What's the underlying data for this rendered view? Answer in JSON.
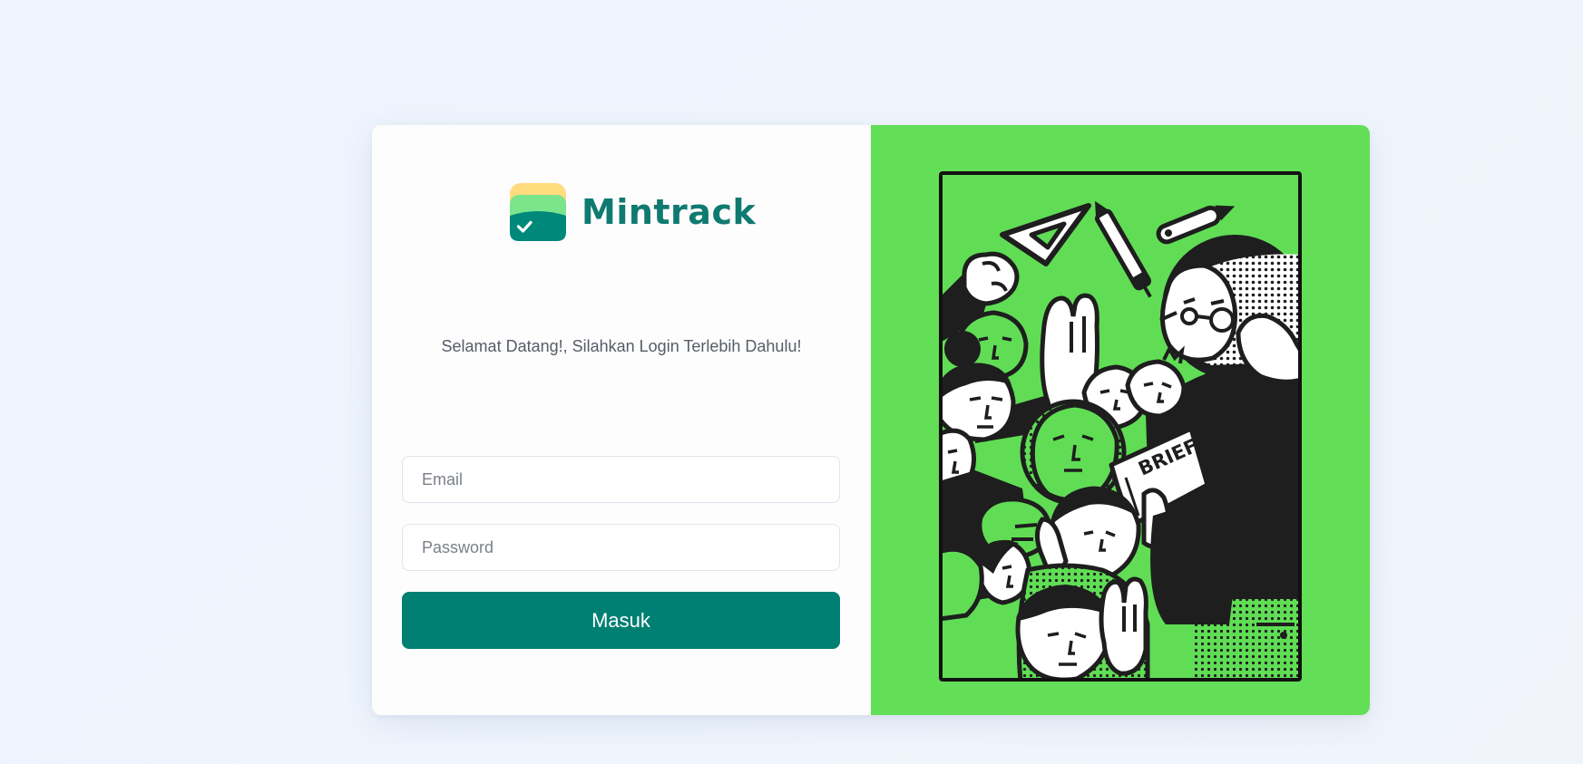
{
  "brand": {
    "name": "Mintrack",
    "icon": "wallet-check-icon",
    "colors": {
      "primary": "#007f73",
      "logo_yellow": "#ffdc7d",
      "logo_light_green": "#7be58c",
      "logo_dark_green": "#00897b"
    }
  },
  "login": {
    "welcome_text": "Selamat Datang!, Silahkan Login Terlebih Dahulu!",
    "email_placeholder": "Email",
    "email_value": "",
    "password_placeholder": "Password",
    "password_value": "",
    "submit_label": "Masuk"
  },
  "illustration": {
    "subject": "crowd-of-people-illustration",
    "paper_text": "BRIEF",
    "background_color": "#63df57"
  }
}
